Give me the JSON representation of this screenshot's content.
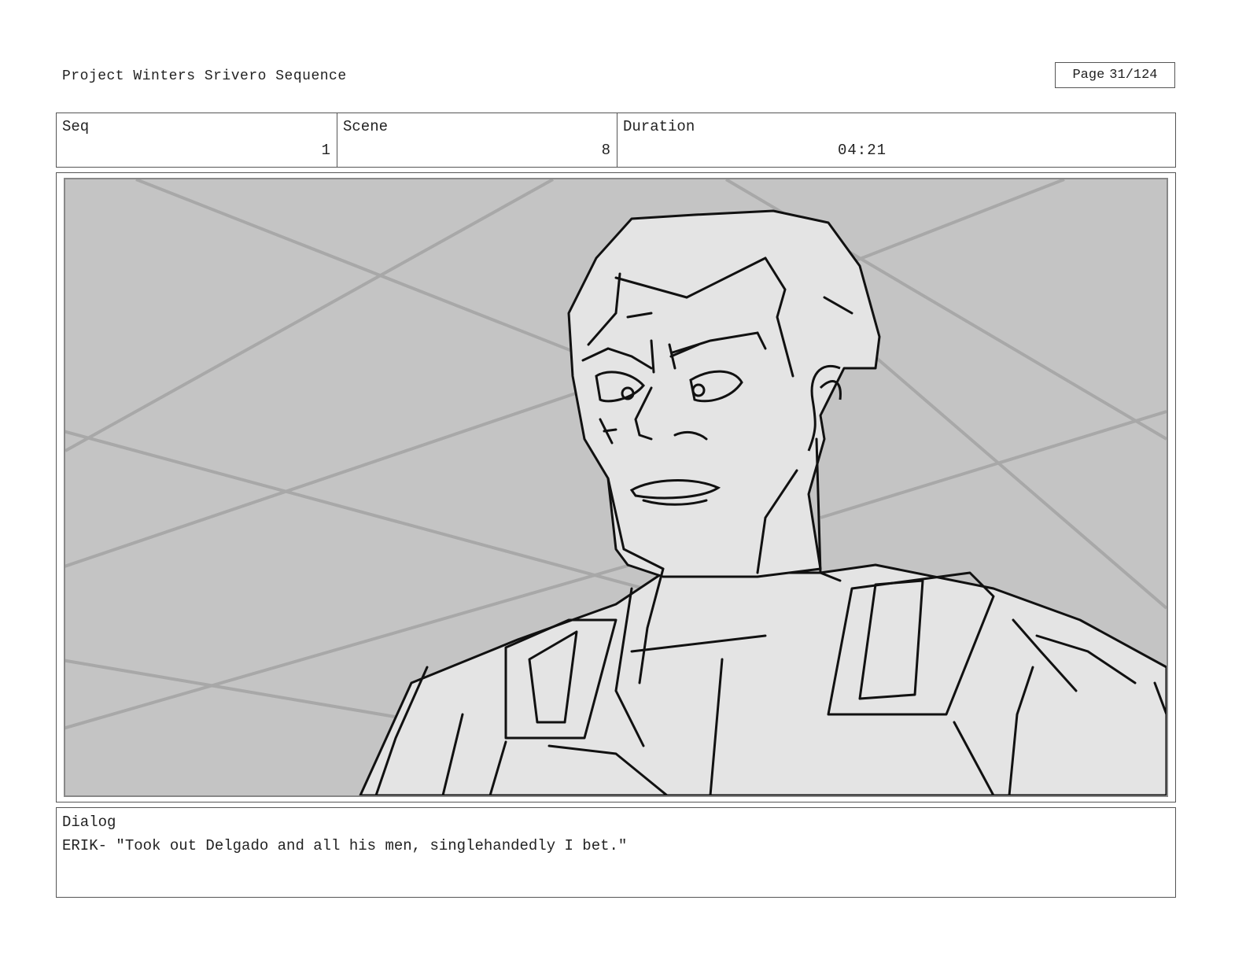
{
  "header": {
    "project_title": "Project Winters Srivero Sequence",
    "page_label": "Page",
    "page_value": "31/124"
  },
  "fields": {
    "seq_label": "Seq",
    "seq_value": "1",
    "scene_label": "Scene",
    "scene_value": "8",
    "duration_label": "Duration",
    "duration_value": "04:21"
  },
  "panel": {
    "background_color": "#c4c4c4",
    "figure_fill": "#e4e4e4",
    "line_color": "#111111"
  },
  "dialog": {
    "label": "Dialog",
    "text": "ERIK- \"Took out Delgado and all his men, singlehandedly I bet.\""
  }
}
